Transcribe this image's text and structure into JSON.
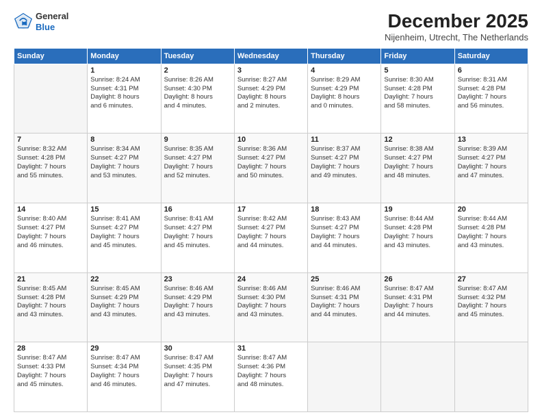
{
  "logo": {
    "general": "General",
    "blue": "Blue"
  },
  "header": {
    "month": "December 2025",
    "location": "Nijenheim, Utrecht, The Netherlands"
  },
  "days_of_week": [
    "Sunday",
    "Monday",
    "Tuesday",
    "Wednesday",
    "Thursday",
    "Friday",
    "Saturday"
  ],
  "weeks": [
    [
      {
        "day": "",
        "info": ""
      },
      {
        "day": "1",
        "info": "Sunrise: 8:24 AM\nSunset: 4:31 PM\nDaylight: 8 hours\nand 6 minutes."
      },
      {
        "day": "2",
        "info": "Sunrise: 8:26 AM\nSunset: 4:30 PM\nDaylight: 8 hours\nand 4 minutes."
      },
      {
        "day": "3",
        "info": "Sunrise: 8:27 AM\nSunset: 4:29 PM\nDaylight: 8 hours\nand 2 minutes."
      },
      {
        "day": "4",
        "info": "Sunrise: 8:29 AM\nSunset: 4:29 PM\nDaylight: 8 hours\nand 0 minutes."
      },
      {
        "day": "5",
        "info": "Sunrise: 8:30 AM\nSunset: 4:28 PM\nDaylight: 7 hours\nand 58 minutes."
      },
      {
        "day": "6",
        "info": "Sunrise: 8:31 AM\nSunset: 4:28 PM\nDaylight: 7 hours\nand 56 minutes."
      }
    ],
    [
      {
        "day": "7",
        "info": "Sunrise: 8:32 AM\nSunset: 4:28 PM\nDaylight: 7 hours\nand 55 minutes."
      },
      {
        "day": "8",
        "info": "Sunrise: 8:34 AM\nSunset: 4:27 PM\nDaylight: 7 hours\nand 53 minutes."
      },
      {
        "day": "9",
        "info": "Sunrise: 8:35 AM\nSunset: 4:27 PM\nDaylight: 7 hours\nand 52 minutes."
      },
      {
        "day": "10",
        "info": "Sunrise: 8:36 AM\nSunset: 4:27 PM\nDaylight: 7 hours\nand 50 minutes."
      },
      {
        "day": "11",
        "info": "Sunrise: 8:37 AM\nSunset: 4:27 PM\nDaylight: 7 hours\nand 49 minutes."
      },
      {
        "day": "12",
        "info": "Sunrise: 8:38 AM\nSunset: 4:27 PM\nDaylight: 7 hours\nand 48 minutes."
      },
      {
        "day": "13",
        "info": "Sunrise: 8:39 AM\nSunset: 4:27 PM\nDaylight: 7 hours\nand 47 minutes."
      }
    ],
    [
      {
        "day": "14",
        "info": "Sunrise: 8:40 AM\nSunset: 4:27 PM\nDaylight: 7 hours\nand 46 minutes."
      },
      {
        "day": "15",
        "info": "Sunrise: 8:41 AM\nSunset: 4:27 PM\nDaylight: 7 hours\nand 45 minutes."
      },
      {
        "day": "16",
        "info": "Sunrise: 8:41 AM\nSunset: 4:27 PM\nDaylight: 7 hours\nand 45 minutes."
      },
      {
        "day": "17",
        "info": "Sunrise: 8:42 AM\nSunset: 4:27 PM\nDaylight: 7 hours\nand 44 minutes."
      },
      {
        "day": "18",
        "info": "Sunrise: 8:43 AM\nSunset: 4:27 PM\nDaylight: 7 hours\nand 44 minutes."
      },
      {
        "day": "19",
        "info": "Sunrise: 8:44 AM\nSunset: 4:28 PM\nDaylight: 7 hours\nand 43 minutes."
      },
      {
        "day": "20",
        "info": "Sunrise: 8:44 AM\nSunset: 4:28 PM\nDaylight: 7 hours\nand 43 minutes."
      }
    ],
    [
      {
        "day": "21",
        "info": "Sunrise: 8:45 AM\nSunset: 4:28 PM\nDaylight: 7 hours\nand 43 minutes."
      },
      {
        "day": "22",
        "info": "Sunrise: 8:45 AM\nSunset: 4:29 PM\nDaylight: 7 hours\nand 43 minutes."
      },
      {
        "day": "23",
        "info": "Sunrise: 8:46 AM\nSunset: 4:29 PM\nDaylight: 7 hours\nand 43 minutes."
      },
      {
        "day": "24",
        "info": "Sunrise: 8:46 AM\nSunset: 4:30 PM\nDaylight: 7 hours\nand 43 minutes."
      },
      {
        "day": "25",
        "info": "Sunrise: 8:46 AM\nSunset: 4:31 PM\nDaylight: 7 hours\nand 44 minutes."
      },
      {
        "day": "26",
        "info": "Sunrise: 8:47 AM\nSunset: 4:31 PM\nDaylight: 7 hours\nand 44 minutes."
      },
      {
        "day": "27",
        "info": "Sunrise: 8:47 AM\nSunset: 4:32 PM\nDaylight: 7 hours\nand 45 minutes."
      }
    ],
    [
      {
        "day": "28",
        "info": "Sunrise: 8:47 AM\nSunset: 4:33 PM\nDaylight: 7 hours\nand 45 minutes."
      },
      {
        "day": "29",
        "info": "Sunrise: 8:47 AM\nSunset: 4:34 PM\nDaylight: 7 hours\nand 46 minutes."
      },
      {
        "day": "30",
        "info": "Sunrise: 8:47 AM\nSunset: 4:35 PM\nDaylight: 7 hours\nand 47 minutes."
      },
      {
        "day": "31",
        "info": "Sunrise: 8:47 AM\nSunset: 4:36 PM\nDaylight: 7 hours\nand 48 minutes."
      },
      {
        "day": "",
        "info": ""
      },
      {
        "day": "",
        "info": ""
      },
      {
        "day": "",
        "info": ""
      }
    ]
  ]
}
